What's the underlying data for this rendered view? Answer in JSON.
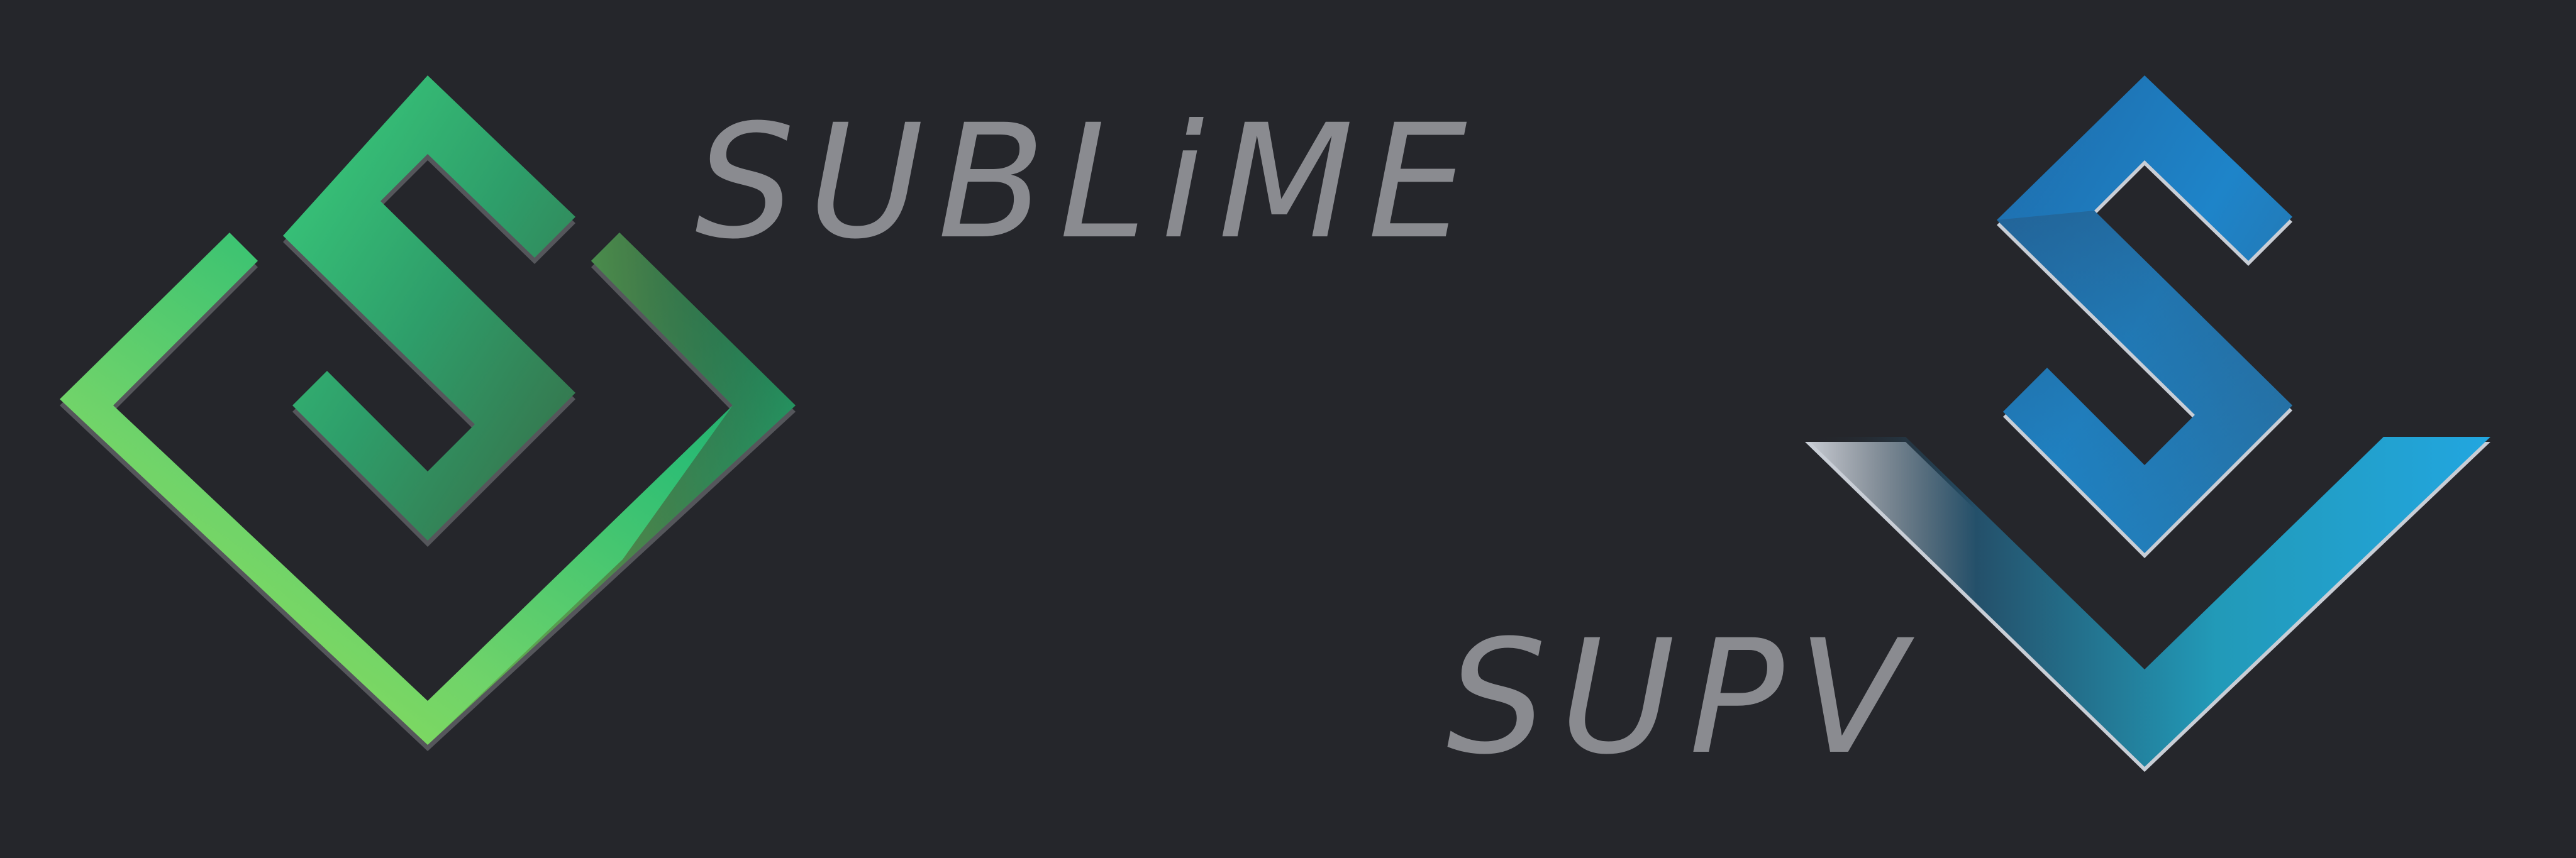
{
  "brands": [
    {
      "name": "SUBLiME",
      "colors": {
        "light": "#8ee35b",
        "mid": "#3fc873",
        "dark": "#2c4a3a",
        "edge": "#6a6b70"
      },
      "icon": "square-s-icon"
    },
    {
      "name": "SUPV",
      "colors": {
        "light": "#28b4e8",
        "mid": "#1e7fcf",
        "dark": "#2a3e58",
        "edge": "#c9ced6"
      },
      "icon": "check-s-icon"
    }
  ],
  "background": "#25262b",
  "text_color": "#8a8b90"
}
